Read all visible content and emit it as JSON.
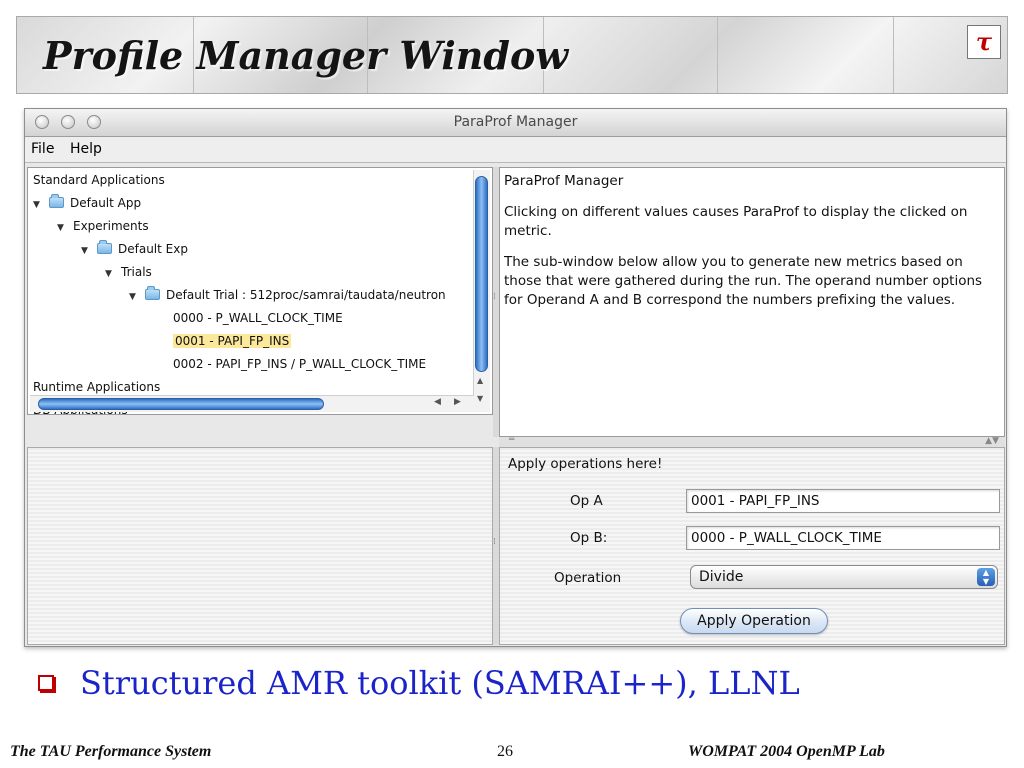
{
  "slide": {
    "title": "Profile Manager Window",
    "logo_text": "τ",
    "bullet": "Structured AMR toolkit (SAMRAI++), LLNL",
    "footer_left": "The TAU Performance System",
    "footer_page": "26",
    "footer_right": "WOMPAT 2004 OpenMP Lab",
    "title_color": "#141414",
    "bullet_color": "#1a24c9",
    "bullet_box_color": "#c00000"
  },
  "window": {
    "title": "ParaProf Manager",
    "menu": [
      "File",
      "Help"
    ]
  },
  "tree": {
    "rows": [
      {
        "label": "Standard Applications",
        "icon": "none",
        "expanded": false
      },
      {
        "label": "Default App",
        "icon": "folder-icon",
        "expanded": true
      },
      {
        "label": "Experiments",
        "icon": "none",
        "expanded": true
      },
      {
        "label": "Default Exp",
        "icon": "folder-icon",
        "expanded": true
      },
      {
        "label": "Trials",
        "icon": "none",
        "expanded": true
      },
      {
        "label": "Default Trial : 512proc/samrai/taudata/neutron",
        "icon": "folder-icon",
        "expanded": true
      },
      {
        "label": "0000 - P_WALL_CLOCK_TIME",
        "icon": "none",
        "expanded": false
      },
      {
        "label": "0001 - PAPI_FP_INS",
        "icon": "none",
        "expanded": false,
        "selected": true
      },
      {
        "label": "0002 - PAPI_FP_INS / P_WALL_CLOCK_TIME",
        "icon": "none",
        "expanded": false
      },
      {
        "label": "Runtime Applications",
        "icon": "none",
        "expanded": false
      },
      {
        "label": "DB Applications",
        "icon": "none",
        "expanded": false
      }
    ]
  },
  "info": {
    "heading": "ParaProf Manager",
    "para1": "Clicking on different values causes ParaProf to display the clicked on metric.",
    "para2": "The sub-window below allow you to generate new metrics based on those that were gathered during the run.  The operand number options for Operand A and B correspond the numbers prefixing the values."
  },
  "ops": {
    "heading": "Apply operations here!",
    "op_a_label": "Op A",
    "op_a_value": "0001 - PAPI_FP_INS",
    "op_b_label": "Op B:",
    "op_b_value": "0000 - P_WALL_CLOCK_TIME",
    "operation_label": "Operation",
    "operation_value": "Divide",
    "apply_label": "Apply Operation"
  }
}
